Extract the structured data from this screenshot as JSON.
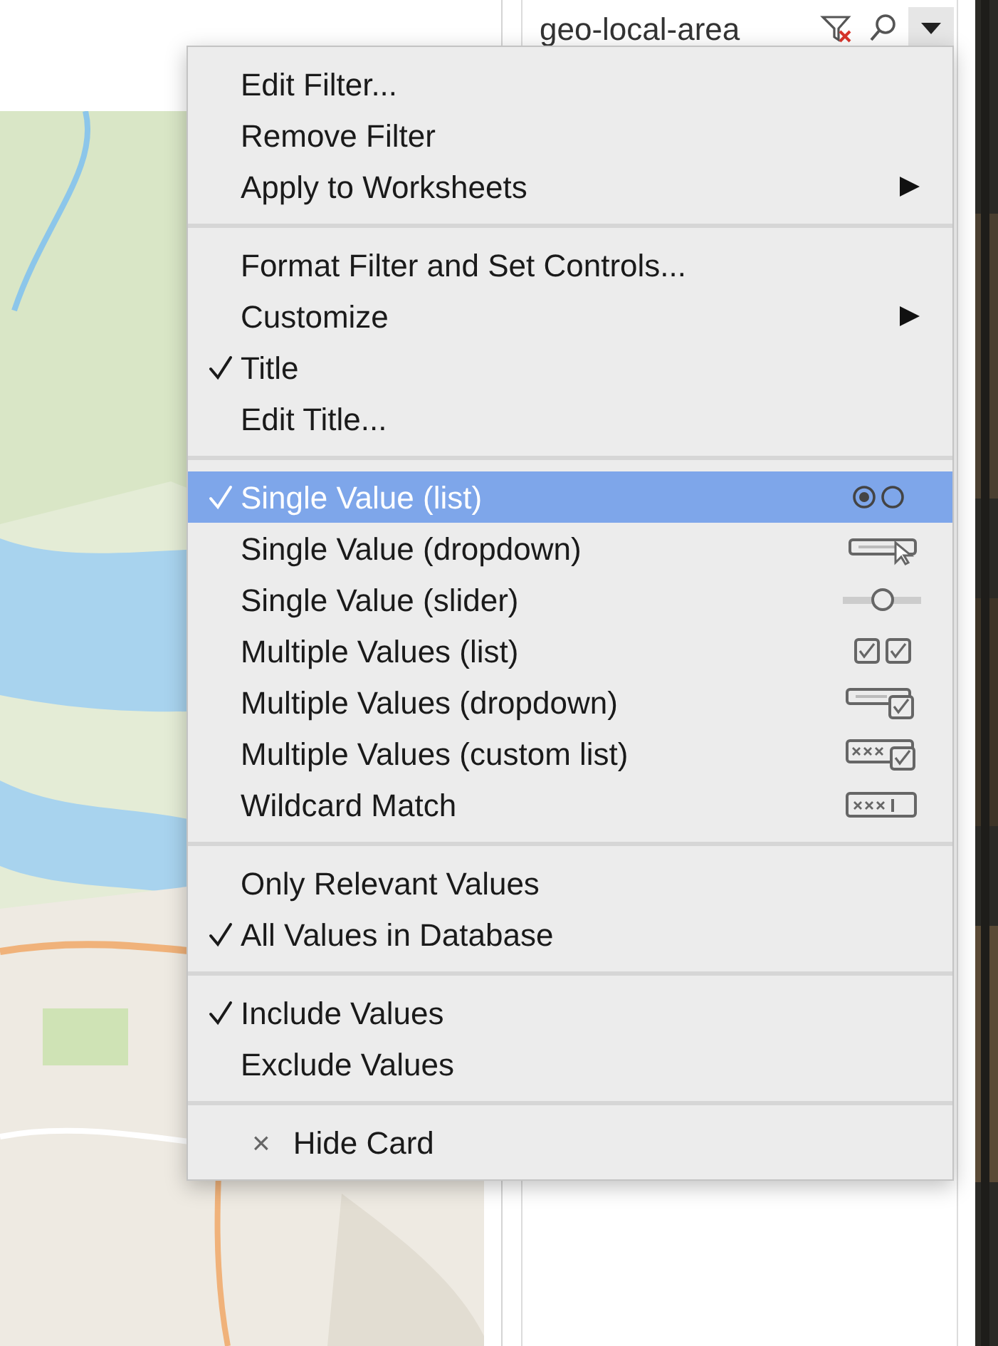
{
  "filter_card": {
    "title": "geo-local-area"
  },
  "menu": {
    "groups": [
      {
        "items": [
          {
            "label": "Edit Filter...",
            "checked": false,
            "selected": false,
            "submenu": false
          },
          {
            "label": "Remove Filter",
            "checked": false,
            "selected": false,
            "submenu": false
          },
          {
            "label": "Apply to Worksheets",
            "checked": false,
            "selected": false,
            "submenu": true
          }
        ]
      },
      {
        "items": [
          {
            "label": "Format Filter and Set Controls...",
            "checked": false,
            "selected": false,
            "submenu": false
          },
          {
            "label": "Customize",
            "checked": false,
            "selected": false,
            "submenu": true
          },
          {
            "label": "Title",
            "checked": true,
            "selected": false,
            "submenu": false
          },
          {
            "label": "Edit Title...",
            "checked": false,
            "selected": false,
            "submenu": false
          }
        ]
      },
      {
        "items": [
          {
            "label": "Single Value (list)",
            "checked": true,
            "selected": true,
            "submenu": false,
            "kind": "radio"
          },
          {
            "label": "Single Value (dropdown)",
            "checked": false,
            "selected": false,
            "submenu": false,
            "kind": "dropdown"
          },
          {
            "label": "Single Value (slider)",
            "checked": false,
            "selected": false,
            "submenu": false,
            "kind": "slider"
          },
          {
            "label": "Multiple Values (list)",
            "checked": false,
            "selected": false,
            "submenu": false,
            "kind": "checklist"
          },
          {
            "label": "Multiple Values (dropdown)",
            "checked": false,
            "selected": false,
            "submenu": false,
            "kind": "multidropdown"
          },
          {
            "label": "Multiple Values (custom list)",
            "checked": false,
            "selected": false,
            "submenu": false,
            "kind": "customlist"
          },
          {
            "label": "Wildcard Match",
            "checked": false,
            "selected": false,
            "submenu": false,
            "kind": "wildcard"
          }
        ]
      },
      {
        "items": [
          {
            "label": "Only Relevant Values",
            "checked": false,
            "selected": false,
            "submenu": false
          },
          {
            "label": "All Values in Database",
            "checked": true,
            "selected": false,
            "submenu": false
          }
        ]
      },
      {
        "items": [
          {
            "label": "Include Values",
            "checked": true,
            "selected": false,
            "submenu": false
          },
          {
            "label": "Exclude Values",
            "checked": false,
            "selected": false,
            "submenu": false
          }
        ]
      },
      {
        "items": [
          {
            "label": "Hide Card",
            "prefix": "×",
            "checked": false,
            "selected": false,
            "submenu": false
          }
        ]
      }
    ]
  }
}
